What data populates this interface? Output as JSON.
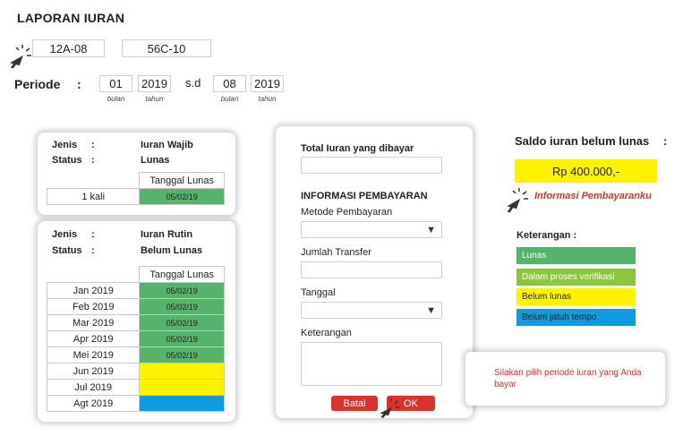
{
  "title": "LAPORAN IURAN",
  "ids": {
    "left": "12A-08",
    "right": "56C-10"
  },
  "periode": {
    "label": "Periode",
    "colon": ":",
    "from_month": "01",
    "from_year": "2019",
    "sd": "s.d",
    "to_month": "08",
    "to_year": "2019",
    "bulan": "bulan",
    "tahun": "tahun"
  },
  "wajib": {
    "jenis_label": "Jenis",
    "status_label": "Status",
    "colon": ":",
    "jenis_value": "Iuran Wajib",
    "status_value": "Lunas",
    "header": "Tanggal Lunas",
    "rows": [
      {
        "label": "1 kali",
        "date": "05/02/19",
        "status": "green"
      }
    ]
  },
  "rutin": {
    "jenis_label": "Jenis",
    "status_label": "Status",
    "colon": ":",
    "jenis_value": "Iuran Rutin",
    "status_value": "Belum Lunas",
    "header": "Tanggal Lunas",
    "rows": [
      {
        "label": "Jan 2019",
        "date": "05/02/19",
        "status": "green"
      },
      {
        "label": "Feb 2019",
        "date": "05/02/19",
        "status": "green"
      },
      {
        "label": "Mar 2019",
        "date": "05/02/19",
        "status": "green"
      },
      {
        "label": "Apr 2019",
        "date": "05/02/19",
        "status": "green"
      },
      {
        "label": "Mei 2019",
        "date": "05/02/19",
        "status": "green"
      },
      {
        "label": "Jun 2019",
        "date": "",
        "status": "yellow"
      },
      {
        "label": "Jul 2019",
        "date": "",
        "status": "yellow"
      },
      {
        "label": "Agt 2019",
        "date": "",
        "status": "blue"
      }
    ]
  },
  "form": {
    "total_label": "Total Iuran yang dibayar",
    "info_heading": "INFORMASI PEMBAYARAN",
    "metode_label": "Metode Pembayaran",
    "jumlah_label": "Jumlah Transfer",
    "tanggal_label": "Tanggal",
    "keterangan_label": "Keterangan",
    "dropdown_icon": "triangle-down",
    "batal": "Batal",
    "ok": "OK"
  },
  "saldo": {
    "label": "Saldo iuran belum lunas",
    "colon": ":",
    "amount": "Rp 400.000,-",
    "info_link": "Informasi Pembayaranku"
  },
  "legend": {
    "title": "Keterangan :",
    "items": [
      {
        "label": "Lunas",
        "color": "#57b36b"
      },
      {
        "label": "Dalam proses verifikasi",
        "color": "#8cc63f"
      },
      {
        "label": "Belum lunas",
        "color": "#fff200"
      },
      {
        "label": "Belum jatuh tempo",
        "color": "#0f9be0"
      }
    ]
  },
  "tooltip": {
    "text": "Silakan pilih periode iuran yang Anda bayar"
  },
  "colors": {
    "green": "#57b36b",
    "yellow": "#fff200",
    "blue": "#0f9be0",
    "red": "#d9342b"
  },
  "icons": {
    "cursor": "click-cursor-icon"
  }
}
